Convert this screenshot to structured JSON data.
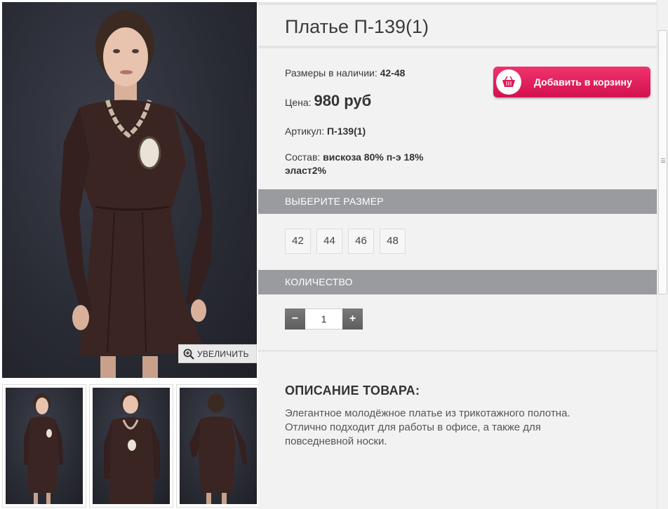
{
  "product": {
    "title": "Платье П-139(1)",
    "sizes_label": "Размеры в наличии:",
    "sizes_value": "42-48",
    "price_label": "Цена:",
    "price_value": "980 руб",
    "article_label": "Артикул:",
    "article_value": "П-139(1)",
    "composition_label": "Состав:",
    "composition_value_line1": "вискоза 80% п-э 18%",
    "composition_value_line2": "эласт2%"
  },
  "cart_button": {
    "label": "Добавить в корзину",
    "icon": "basket-icon",
    "color": "#e0185a"
  },
  "gallery": {
    "zoom_label": "УВЕЛИЧИТЬ",
    "zoom_icon": "magnifier-plus-icon",
    "thumbnails": [
      "front-view",
      "front-view-2",
      "back-view"
    ]
  },
  "size_section": {
    "title": "ВЫБЕРИТЕ РАЗМЕР",
    "sizes": [
      "42",
      "44",
      "46",
      "48"
    ]
  },
  "quantity_section": {
    "title": "КОЛИЧЕСТВО",
    "minus": "−",
    "plus": "+",
    "value": "1"
  },
  "description": {
    "title": "ОПИСАНИЕ ТОВАРА:",
    "line1": "Элегантное молодёжное платье из трикотажного полотна.",
    "line2": "Отлично подходит для работы в офисе, а также для",
    "line3": "повседневной носки."
  },
  "colors": {
    "section_bar": "#999b9e",
    "panel_bg": "#f2f2f2",
    "dress": "#3a2523"
  }
}
